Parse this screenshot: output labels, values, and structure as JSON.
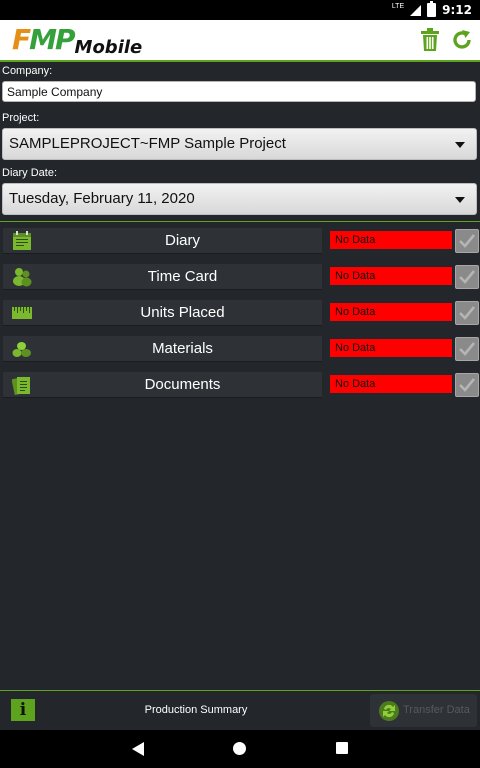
{
  "status_bar": {
    "network": "LTE",
    "time": "9:12"
  },
  "app": {
    "logo_f": "F",
    "logo_mp": "MP",
    "logo_mobile": "Mobile"
  },
  "form": {
    "company_label": "Company:",
    "company_value": "Sample Company",
    "project_label": "Project:",
    "project_value": "SAMPLEPROJECT~FMP Sample Project",
    "diary_date_label": "Diary Date:",
    "diary_date_value": "Tuesday, February 11, 2020"
  },
  "rows": [
    {
      "label": "Diary",
      "icon": "diary-icon",
      "status": "No Data"
    },
    {
      "label": "Time Card",
      "icon": "people-icon",
      "status": "No Data"
    },
    {
      "label": "Units Placed",
      "icon": "ruler-icon",
      "status": "No Data"
    },
    {
      "label": "Materials",
      "icon": "materials-icon",
      "status": "No Data"
    },
    {
      "label": "Documents",
      "icon": "documents-icon",
      "status": "No Data"
    }
  ],
  "bottom": {
    "info_label": "i",
    "production_summary_label": "Production Summary",
    "transfer_data_label": "Transfer Data"
  },
  "colors": {
    "accent_green": "#5ea31e",
    "status_red": "#ff0000",
    "background": "#23262a"
  }
}
